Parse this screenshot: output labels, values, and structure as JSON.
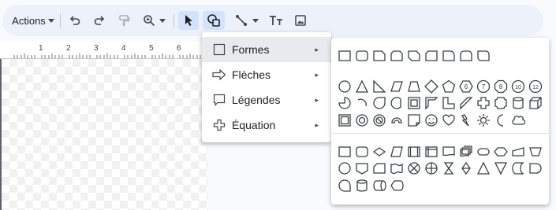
{
  "toolbar": {
    "actions_label": "Actions"
  },
  "ruler": {
    "numbers": [
      "1",
      "2",
      "3",
      "4",
      "5",
      "6"
    ]
  },
  "menu": {
    "items": [
      {
        "label": "Formes",
        "icon": "square-icon",
        "highlighted": true
      },
      {
        "label": "Flèches",
        "icon": "arrow-right-icon"
      },
      {
        "label": "Légendes",
        "icon": "callout-icon"
      },
      {
        "label": "Équation",
        "icon": "plus-icon"
      }
    ],
    "arrow_glyph": "▸"
  },
  "submenu": {
    "sections": [
      "shapes",
      "flowchart"
    ]
  },
  "colors": {
    "toolbar_bg": "#edf2fa",
    "selected_tool_bg": "#d3e3fd",
    "menu_highlight": "#e8eaed"
  }
}
